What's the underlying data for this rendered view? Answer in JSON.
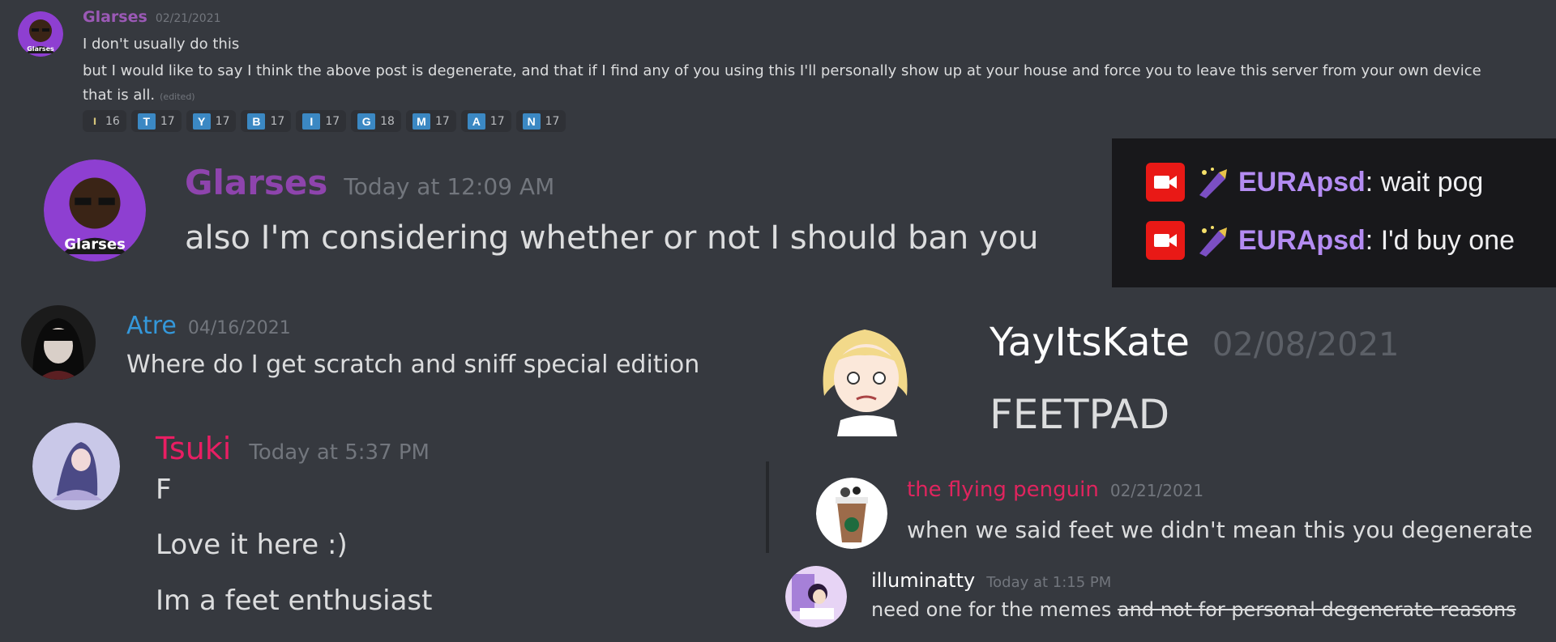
{
  "panel1": {
    "author": "Glarses",
    "timestamp": "02/21/2021",
    "lines": [
      "I don't usually do this",
      "but I would like to say I think the above post is degenerate, and that if I find any of you using this I'll personally show up at your house and force you to leave this server from your own device",
      "that is all."
    ],
    "edited_label": "(edited)",
    "reactions": [
      {
        "emoji": "dart-icon",
        "glyph": "ı",
        "count": "16"
      },
      {
        "emoji": "regional-indicator-t-icon",
        "glyph": "T",
        "count": "17"
      },
      {
        "emoji": "regional-indicator-y-icon",
        "glyph": "Y",
        "count": "17"
      },
      {
        "emoji": "regional-indicator-b-icon",
        "glyph": "B",
        "count": "17"
      },
      {
        "emoji": "regional-indicator-i-icon",
        "glyph": "I",
        "count": "17"
      },
      {
        "emoji": "regional-indicator-g-icon",
        "glyph": "G",
        "count": "18"
      },
      {
        "emoji": "regional-indicator-m-icon",
        "glyph": "M",
        "count": "17"
      },
      {
        "emoji": "regional-indicator-a-icon",
        "glyph": "A",
        "count": "17"
      },
      {
        "emoji": "regional-indicator-n-icon",
        "glyph": "N",
        "count": "17"
      }
    ]
  },
  "panel2": {
    "author": "Glarses",
    "timestamp": "Today at 12:09 AM",
    "message": "also I'm considering whether or not I should ban you"
  },
  "panel3": {
    "lines": [
      {
        "user": "EURApsd",
        "text": ": wait pog"
      },
      {
        "user": "EURApsd",
        "text": ": I'd buy one"
      }
    ],
    "colors": {
      "camera": "#e91916",
      "username": "#b48cf2",
      "background": "#18181b"
    }
  },
  "panel4": {
    "author": "Atre",
    "timestamp": "04/16/2021",
    "message": "Where do I get scratch and sniff special edition"
  },
  "panel5": {
    "author": "Tsuki",
    "timestamp": "Today at 5:37 PM",
    "lines": [
      "F",
      "Love it here :)",
      "Im a feet enthusiast"
    ]
  },
  "panel6": {
    "author": "YayItsKate",
    "timestamp": "02/08/2021",
    "message": "FEETPAD"
  },
  "panel7": {
    "author": "the flying penguin",
    "timestamp": "02/21/2021",
    "message": "when we said feet we didn't mean this you degenerate"
  },
  "panel8": {
    "author": "illuminatty",
    "timestamp": "Today at 1:15 PM",
    "message": "need one for the memes ",
    "struck": "and not for personal degenerate reasons"
  },
  "colors": {
    "background": "#36393f",
    "glarses": "#9b59b6",
    "atre": "#3498db",
    "tsuki": "#e91e63",
    "penguin": "#e0245e"
  }
}
